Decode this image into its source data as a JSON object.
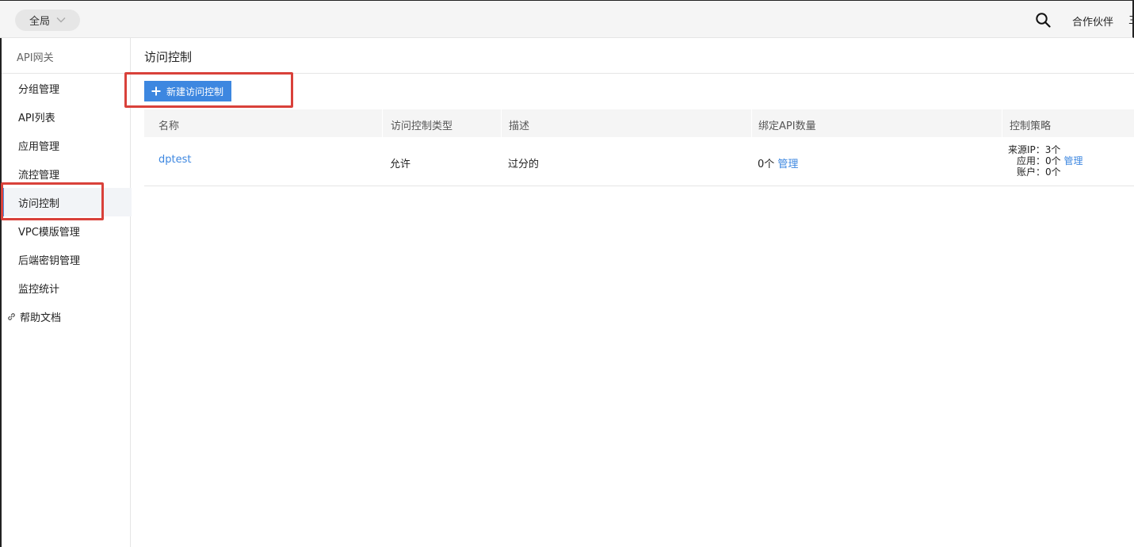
{
  "topbar": {
    "region": "全局",
    "partner": "合作伙伴",
    "overflow": "三"
  },
  "sidebar": {
    "title": "API网关",
    "items": [
      {
        "label": "分组管理"
      },
      {
        "label": "API列表"
      },
      {
        "label": "应用管理"
      },
      {
        "label": "流控管理"
      },
      {
        "label": "访问控制",
        "active": true
      },
      {
        "label": "VPC模版管理"
      },
      {
        "label": "后端密钥管理"
      },
      {
        "label": "监控统计"
      }
    ],
    "help": "帮助文档"
  },
  "main": {
    "title": "访问控制",
    "new_button": "新建访问控制",
    "table": {
      "headers": [
        "名称",
        "访问控制类型",
        "描述",
        "绑定API数量",
        "控制策略"
      ],
      "rows": [
        {
          "name": "dptest",
          "type": "允许",
          "description": "过分的",
          "api_count": "0个",
          "manage": "管理",
          "policy": {
            "source_ip": "来源IP：3个",
            "app": "应用：0个",
            "app_manage": "管理",
            "account": "账户：0个"
          }
        }
      ]
    }
  },
  "colors": {
    "accent": "#3d87e0",
    "highlight": "#d9413a"
  }
}
